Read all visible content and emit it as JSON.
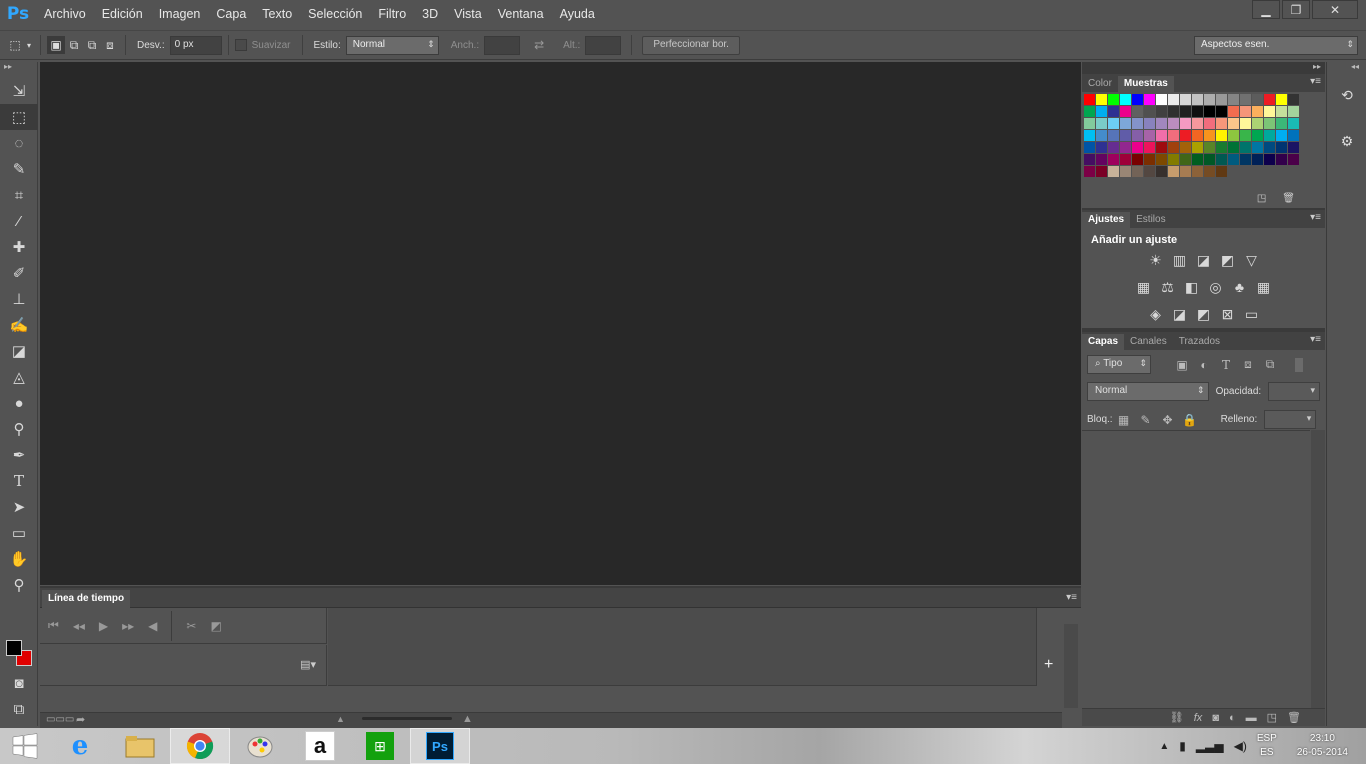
{
  "app": {
    "logo": "Ps"
  },
  "menu": [
    "Archivo",
    "Edición",
    "Imagen",
    "Capa",
    "Texto",
    "Selección",
    "Filtro",
    "3D",
    "Vista",
    "Ventana",
    "Ayuda"
  ],
  "window_controls": {
    "minimize": "▁",
    "restore": "❐",
    "close": "✕"
  },
  "options": {
    "feather_label": "Desv.:",
    "feather_value": "0 px",
    "antialias_label": "Suavizar",
    "style_label": "Estilo:",
    "style_value": "Normal",
    "width_label": "Anch.:",
    "height_label": "Alt.:",
    "refine_label": "Perfeccionar bor.",
    "workspace_value": "Aspectos esen."
  },
  "timeline": {
    "tab": "Línea de tiempo",
    "add": "+"
  },
  "color_panel": {
    "tabs": [
      "Color",
      "Muestras"
    ],
    "active": "Muestras",
    "swatches": [
      "#ff0000",
      "#ffff00",
      "#00ff00",
      "#00ffff",
      "#0000ff",
      "#ff00ff",
      "#ffffff",
      "#ebebeb",
      "#d6d6d6",
      "#c2c2c2",
      "#adadad",
      "#999999",
      "#858585",
      "#707070",
      "#5c5c5c",
      "#ed1c24",
      "#ffff00",
      "#333333",
      "#00a650",
      "#00aeef",
      "#2e3192",
      "#ec008c",
      "#606060",
      "#505050",
      "#404040",
      "#303030",
      "#202020",
      "#101010",
      "#000000",
      "#000000",
      "#f26c4f",
      "#f69679",
      "#fbaf5d",
      "#fff799",
      "#c4df9b",
      "#a3d39c",
      "#82ca9c",
      "#7accc8",
      "#6dcff6",
      "#7da7d9",
      "#8493ca",
      "#8882be",
      "#a187be",
      "#bc8dbf",
      "#f49ac2",
      "#f6989d",
      "#f26d7d",
      "#f7977a",
      "#fdc68a",
      "#fff79a",
      "#acd373",
      "#7cc576",
      "#3bb878",
      "#1abbb4",
      "#00bff3",
      "#448ccb",
      "#5674b9",
      "#605ca8",
      "#855fa8",
      "#a763a8",
      "#f06eaa",
      "#f26d7d",
      "#ed1c24",
      "#f26522",
      "#f7941d",
      "#fff200",
      "#8dc63f",
      "#39b54a",
      "#00a651",
      "#00a99d",
      "#00aef0",
      "#0072bc",
      "#0054a6",
      "#2e3192",
      "#662d91",
      "#92278f",
      "#ec008c",
      "#ed145b",
      "#9e0b0f",
      "#a0410d",
      "#a36209",
      "#aba000",
      "#598527",
      "#197b30",
      "#007236",
      "#00746b",
      "#0076a3",
      "#004a80",
      "#003471",
      "#1b1464",
      "#440e62",
      "#630460",
      "#9e005d",
      "#9e0039",
      "#790000",
      "#7b2e00",
      "#7d4900",
      "#827b00",
      "#406618",
      "#005e20",
      "#005826",
      "#005952",
      "#005b7f",
      "#003663",
      "#002157",
      "#0d004c",
      "#32004b",
      "#4b0049",
      "#7b0046",
      "#7a0026",
      "#c7b299",
      "#998675",
      "#736357",
      "#534741",
      "#37302d",
      "#c69c6d",
      "#a67c52",
      "#8c6239",
      "#754c24",
      "#603913"
    ]
  },
  "adjustments_panel": {
    "tabs": [
      "Ajustes",
      "Estilos"
    ],
    "active": "Ajustes",
    "title": "Añadir un ajuste",
    "row1": [
      "☀",
      "▥",
      "◪",
      "◩",
      "▽"
    ],
    "row2": [
      "▦",
      "⚖",
      "◧",
      "◎",
      "♣",
      "▦"
    ],
    "row3": [
      "◈",
      "◪",
      "◩",
      "⊠",
      "▭"
    ]
  },
  "layers_panel": {
    "tabs": [
      "Capas",
      "Canales",
      "Trazados"
    ],
    "active": "Capas",
    "filter_value": "⌕ Tipo",
    "blend_value": "Normal",
    "opacity_label": "Opacidad:",
    "lock_label": "Bloq.:",
    "fill_label": "Relleno:"
  },
  "taskbar": {
    "apps": [
      "internet-explorer",
      "file-explorer",
      "chrome",
      "paint",
      "amazon",
      "store",
      "photoshop"
    ],
    "lang_top": "ESP",
    "lang_bottom": "ES",
    "time": "23:10",
    "date": "26-05-2014"
  }
}
